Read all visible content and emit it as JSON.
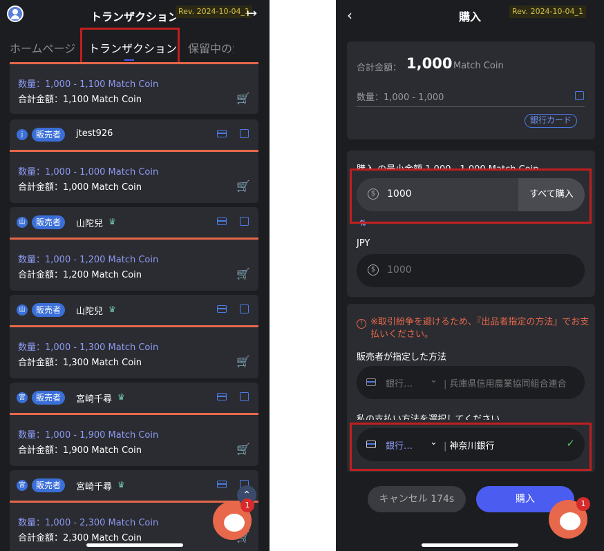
{
  "left": {
    "title": "トランザクション",
    "rev": "Rev. 2024-10-04_1",
    "tabs": [
      "ホームページ",
      "トランザクション",
      "保留中の注"
    ],
    "top_item": {
      "qty": "数量：1,000 - 1,100 Match Coin",
      "total": "合計金額：1,100 Match Coin"
    },
    "items": [
      {
        "avatar": "j",
        "role": "販売者",
        "seller": "jtest926",
        "crown": false,
        "qty": "数量：1,000 - 1,000 Match Coin",
        "total": "合計金額：1,000 Match Coin"
      },
      {
        "avatar": "山",
        "role": "販売者",
        "seller": "山陀兒",
        "crown": true,
        "qty": "数量：1,000 - 1,200 Match Coin",
        "total": "合計金額：1,200 Match Coin"
      },
      {
        "avatar": "山",
        "role": "販売者",
        "seller": "山陀兒",
        "crown": true,
        "qty": "数量：1,000 - 1,300 Match Coin",
        "total": "合計金額：1,300 Match Coin"
      },
      {
        "avatar": "宮",
        "role": "販売者",
        "seller": "宮崎千尋",
        "crown": true,
        "qty": "数量：1,000 - 1,900 Match Coin",
        "total": "合計金額：1,900 Match Coin"
      },
      {
        "avatar": "宮",
        "role": "販売者",
        "seller": "宮崎千尋",
        "crown": true,
        "qty": "数量：1,000 - 2,300 Match Coin",
        "total": "合計金額：2,300 Match Coin"
      }
    ],
    "chat_badge": "1"
  },
  "right": {
    "title": "購入",
    "rev": "Rev. 2024-10-04_1",
    "total_label": "合計金額：",
    "total_value": "1,000",
    "total_unit": "Match Coin",
    "qty_label": "数量：1,000 -  1,000",
    "bank_card_label": "銀行カード",
    "min_label": "購入 の最小金額 1,000 - 1,000 Match Coin",
    "amount_value": "1000",
    "buy_all_label": "すべて購入",
    "jpy_label": "JPY",
    "jpy_value": "1000",
    "warning": "※取引紛争を避けるため、『出品者指定の方法』でお支払いください。",
    "seller_method_label": "販売者が指定した方法",
    "seller_method_type": "銀行…",
    "seller_method_bank": "兵庫県信用農業協同組合連合",
    "my_method_label": "私の支払い方法を選択してください",
    "my_method_type": "銀行…",
    "my_method_bank": "神奈川銀行",
    "cancel_label": "キャンセル 174s",
    "buy_label": "購入",
    "chat_badge": "1"
  }
}
